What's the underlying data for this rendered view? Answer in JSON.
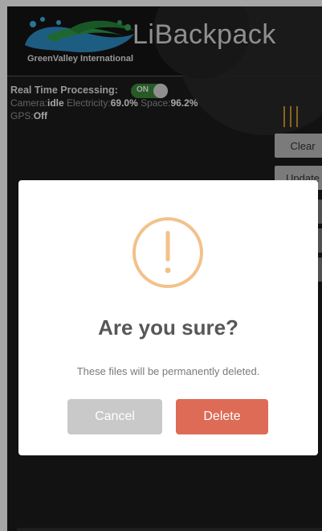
{
  "header": {
    "company": "GreenValley International",
    "title": "LiBackpack"
  },
  "status": {
    "rtp_label": "Real Time Processing:",
    "toggle_label": "ON",
    "camera_key": "Camera:",
    "camera_value": "idle",
    "electricity_key": "Electricity:",
    "electricity_value": "69.0%",
    "space_key": "Space:",
    "space_value": "96.2%",
    "gps_key": "GPS:",
    "gps_value": "Off"
  },
  "side_buttons": {
    "clear": "Clear",
    "update": "Update"
  },
  "dialog": {
    "title": "Are you sure?",
    "message": "These files will be permanently deleted.",
    "cancel": "Cancel",
    "delete": "Delete"
  },
  "colors": {
    "warning": "#f3c18a",
    "delete": "#dd6b55",
    "cancel": "#c9c9c9",
    "toggle_on": "#3b8a3b",
    "menu_icon": "#d49a2e"
  },
  "icons": [
    "logo-icon",
    "menu-icon",
    "warning-icon"
  ]
}
